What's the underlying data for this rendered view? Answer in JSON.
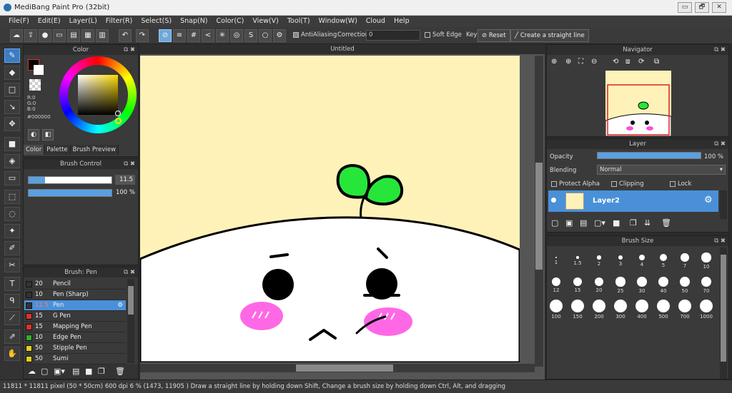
{
  "window": {
    "title": "MediBang Paint Pro (32bit)",
    "controls": [
      "▭",
      "🗗",
      "✕"
    ]
  },
  "menu": [
    "File(F)",
    "Edit(E)",
    "Layer(L)",
    "Filter(R)",
    "Select(S)",
    "Snap(N)",
    "Color(C)",
    "View(V)",
    "Tool(T)",
    "Window(W)",
    "Cloud",
    "Help"
  ],
  "toolbar": {
    "antialiasing": "AntiAliasing",
    "correction_label": "Correction",
    "correction_value": "0",
    "soft_edge": "Soft Edge",
    "key": "Key",
    "reset": "Reset",
    "straight_line": "Create a straight line"
  },
  "color_panel": {
    "title": "Color",
    "r": "R:0",
    "g": "G:0",
    "b": "B:0",
    "hex": "#000000",
    "tabs": [
      "Color",
      "Palette",
      "Brush Preview"
    ],
    "current_color": "#000000"
  },
  "brush_control": {
    "title": "Brush Control",
    "size": "11.5",
    "opacity": "100 %",
    "size_fraction": 0.2,
    "opacity_fraction": 1.0
  },
  "brush_list": {
    "title": "Brush: Pen",
    "items": [
      {
        "size": "20",
        "name": "Pencil",
        "color": "#333333"
      },
      {
        "size": "10",
        "name": "Pen (Sharp)",
        "color": "#333333"
      },
      {
        "size": "11.5",
        "name": "Pen",
        "color": "#333333",
        "selected": true
      },
      {
        "size": "15",
        "name": "G Pen",
        "color": "#e03030"
      },
      {
        "size": "15",
        "name": "Mapping Pen",
        "color": "#e03030"
      },
      {
        "size": "10",
        "name": "Edge Pen",
        "color": "#30b030"
      },
      {
        "size": "50",
        "name": "Stipple Pen",
        "color": "#e0d020"
      },
      {
        "size": "50",
        "name": "Sumi",
        "color": "#e0d020"
      }
    ]
  },
  "canvas": {
    "tab": "Untitled"
  },
  "navigator": {
    "title": "Navigator"
  },
  "layer_panel": {
    "title": "Layer",
    "opacity_label": "Opacity",
    "opacity_value": "100 %",
    "blending_label": "Blending",
    "blending_value": "Normal",
    "protect_alpha": "Protect Alpha",
    "clipping": "Clipping",
    "lock": "Lock",
    "layer_name": "Layer2"
  },
  "brush_size": {
    "title": "Brush Size",
    "sizes": [
      "1",
      "1.5",
      "2",
      "3",
      "4",
      "5",
      "7",
      "10",
      "12",
      "15",
      "20",
      "25",
      "30",
      "40",
      "50",
      "70",
      "100",
      "150",
      "200",
      "300",
      "400",
      "500",
      "700",
      "1000"
    ]
  },
  "status": {
    "text": "11811 * 11811 pixel  (50 * 50cm)  600 dpi  6 %  (1473, 11905 )  Draw a straight line by holding down Shift, Change a brush size by holding down Ctrl, Alt, and dragging"
  }
}
